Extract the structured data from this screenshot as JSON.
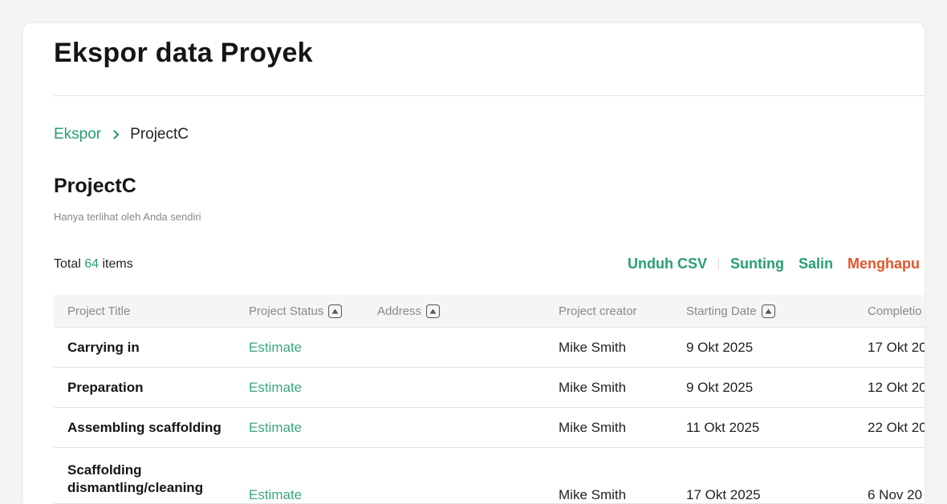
{
  "header": {
    "title": "Ekspor data Proyek"
  },
  "breadcrumb": {
    "parent": "Ekspor",
    "current": "ProjectC"
  },
  "project": {
    "name": "ProjectC",
    "visibility": "Hanya terlihat oleh Anda sendiri"
  },
  "summary": {
    "prefix": "Total",
    "count": "64",
    "suffix": "items"
  },
  "actions": {
    "download_csv": "Unduh CSV",
    "edit": "Sunting",
    "copy": "Salin",
    "delete": "Menghapu"
  },
  "table": {
    "columns": [
      "Project Title",
      "Project Status",
      "Address",
      "Project creator",
      "Starting Date",
      "Completio"
    ],
    "rows": [
      {
        "title": "Carrying in",
        "status": "Estimate",
        "address": "",
        "creator": "Mike Smith",
        "start": "9 Okt 2025",
        "completion": "17 Okt 20"
      },
      {
        "title": "Preparation",
        "status": "Estimate",
        "address": "",
        "creator": "Mike Smith",
        "start": "9 Okt 2025",
        "completion": "12 Okt 20"
      },
      {
        "title": "Assembling scaffolding",
        "status": "Estimate",
        "address": "",
        "creator": "Mike Smith",
        "start": "11 Okt 2025",
        "completion": "22 Okt 20"
      },
      {
        "title": "Scaffolding dismantling/cleaning",
        "status": "Estimate",
        "address": "",
        "creator": "Mike Smith",
        "start": "17 Okt 2025",
        "completion": "6 Nov 20"
      }
    ]
  },
  "colors": {
    "accent": "#27a06f",
    "danger": "#e2552c"
  }
}
